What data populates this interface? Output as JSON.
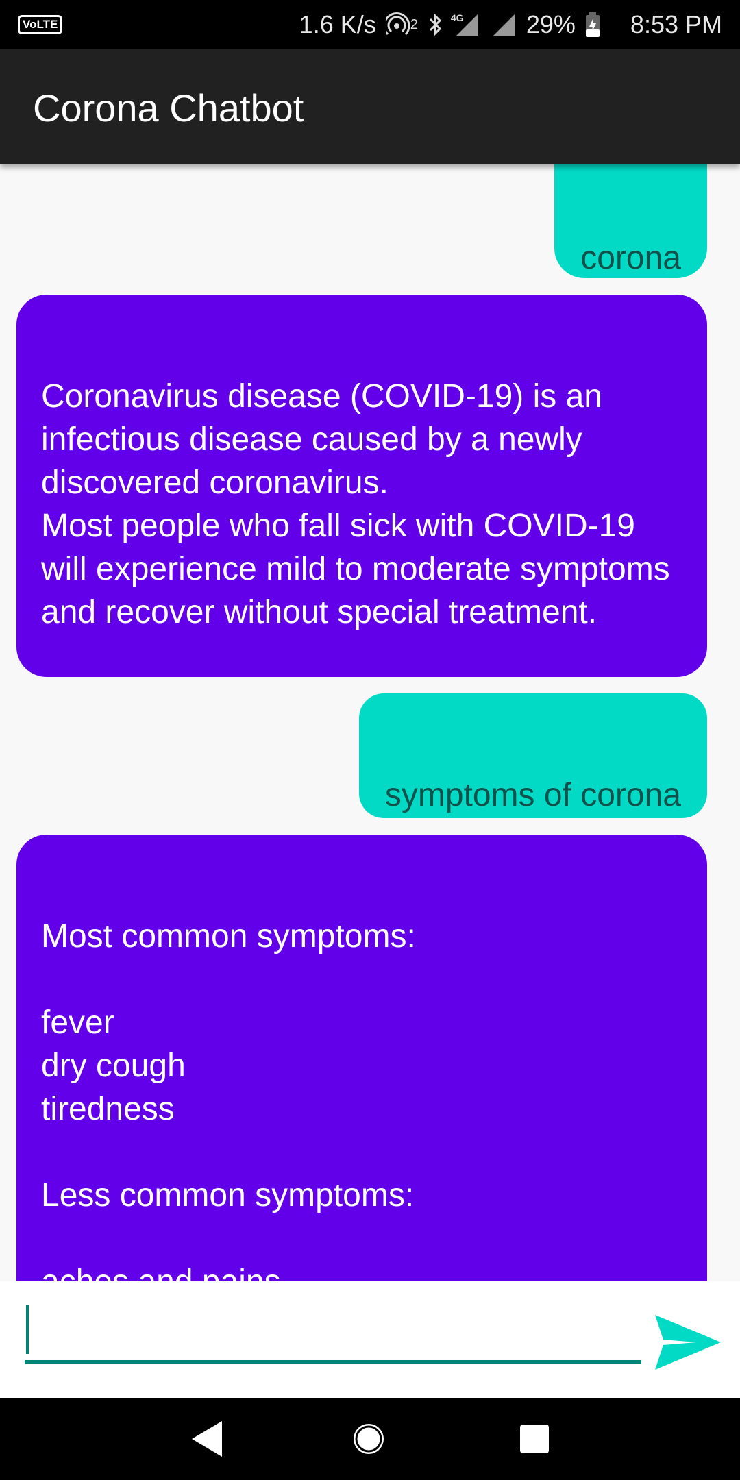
{
  "status_bar": {
    "volte": "VoLTE",
    "speed": "1.6 K/s",
    "hotspot_superscript": "2",
    "network": "4G",
    "battery": "29%",
    "time": "8:53 PM",
    "icons": [
      "hotspot-icon",
      "bluetooth-icon",
      "signal-icon",
      "signal-icon",
      "battery-charging-icon"
    ]
  },
  "app_bar": {
    "title": "Corona Chatbot"
  },
  "messages": [
    {
      "sender": "user",
      "text": "corona"
    },
    {
      "sender": "bot",
      "text": "Coronavirus disease (COVID-19) is an infectious disease caused by a newly discovered coronavirus.\nMost people who fall sick with COVID-19 will experience mild to moderate symptoms and recover without special treatment."
    },
    {
      "sender": "user",
      "text": "symptoms of corona"
    },
    {
      "sender": "bot",
      "text": "Most common symptoms:\n\nfever\ndry cough\ntiredness\n\nLess common symptoms:\n\naches and pains\nsore throat"
    }
  ],
  "input": {
    "value": "",
    "placeholder": ""
  },
  "send_button": {
    "icon": "send-icon",
    "color": "#03dac5"
  },
  "nav_bar": {
    "icons": [
      "back-icon",
      "home-icon",
      "recents-icon"
    ]
  },
  "colors": {
    "app_bar": "#212121",
    "user_bubble": "#03dac5",
    "bot_bubble": "#6200ea",
    "input_underline": "#008577"
  }
}
